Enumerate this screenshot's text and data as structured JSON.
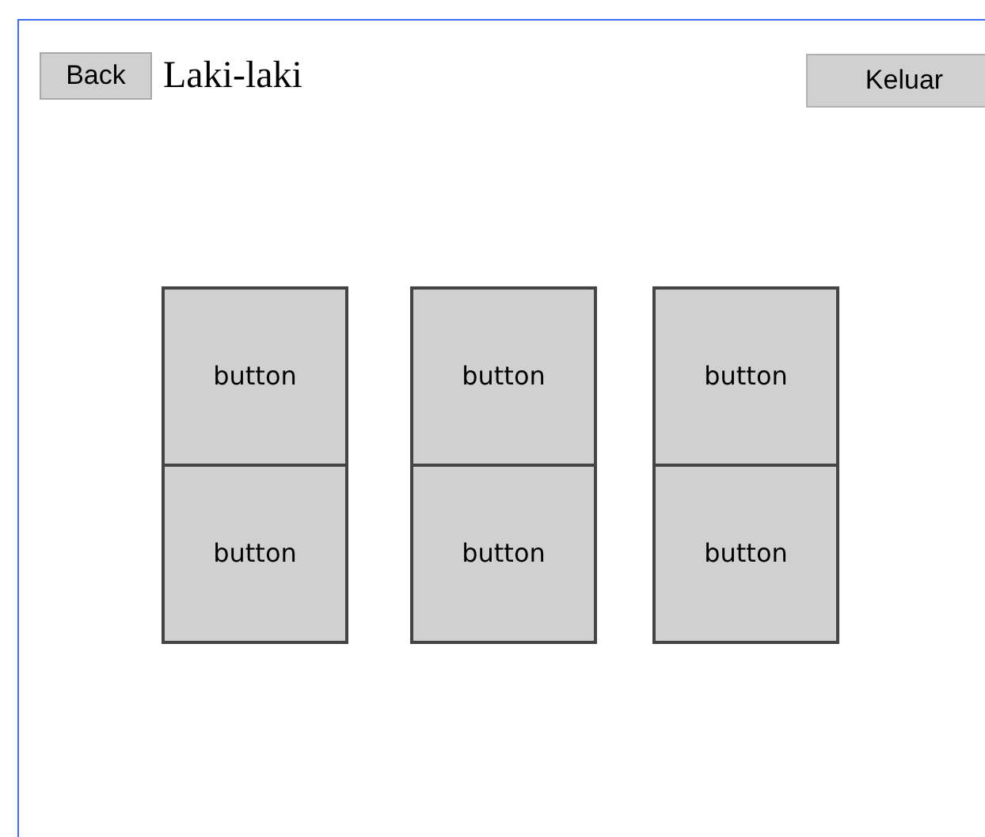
{
  "header": {
    "back_button": "Back",
    "title": "Laki-laki",
    "exit_button": "Keluar"
  },
  "grid": [
    [
      "button",
      "button"
    ],
    [
      "button",
      "button"
    ],
    [
      "button",
      "button"
    ]
  ]
}
